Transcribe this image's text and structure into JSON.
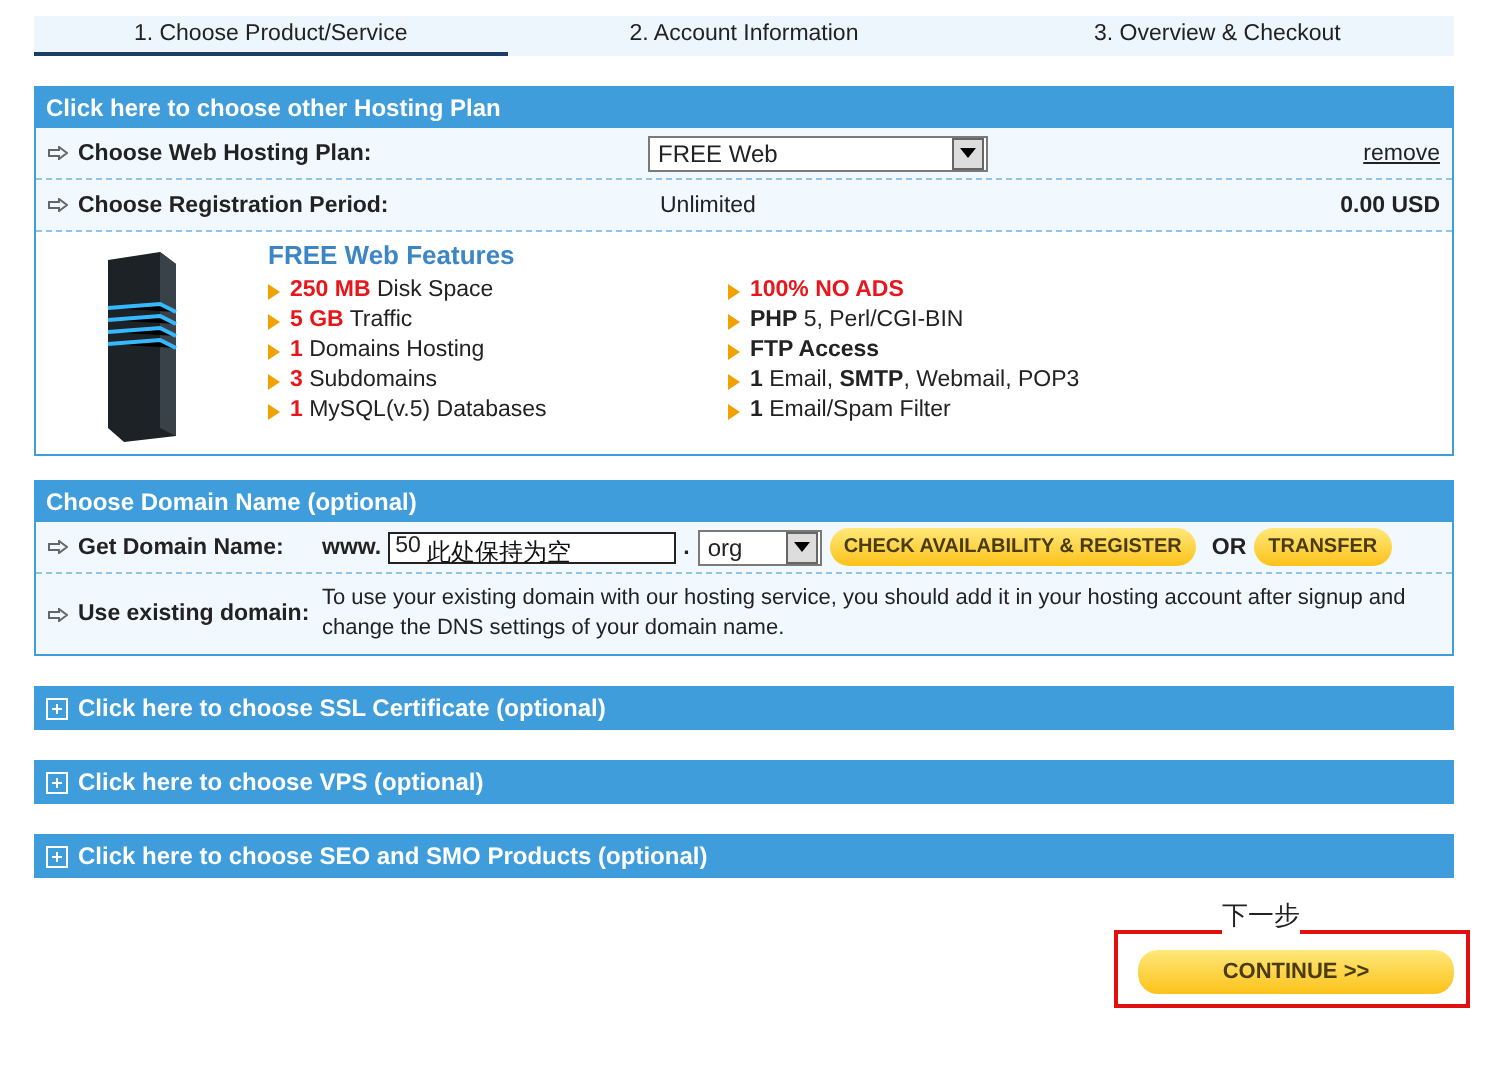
{
  "steps": [
    {
      "label": "1. Choose Product/Service",
      "selected": true
    },
    {
      "label": "2. Account Information",
      "selected": false
    },
    {
      "label": "3. Overview & Checkout",
      "selected": false
    }
  ],
  "hosting": {
    "header": "Click here to choose other Hosting Plan",
    "plan_label": "Choose Web Hosting Plan:",
    "plan_value": "FREE Web",
    "remove": "remove",
    "period_label": "Choose Registration Period:",
    "period_value": "Unlimited",
    "price": "0.00 USD",
    "features_title": "FREE Web Features",
    "features_left": [
      {
        "text": "**250 MB** Disk Space",
        "kind": "red"
      },
      {
        "text": "**5 GB** Traffic",
        "kind": "red"
      },
      {
        "text": "**1** Domains Hosting",
        "kind": "red"
      },
      {
        "text": "**3** Subdomains",
        "kind": "red"
      },
      {
        "text": "**1** MySQL(v.5) Databases",
        "kind": "red"
      }
    ],
    "features_right": [
      {
        "text": "100% NO ADS",
        "kind": "alert"
      },
      {
        "text": "**PHP** 5, Perl/CGI-BIN",
        "kind": "plain"
      },
      {
        "text": "FTP Access",
        "kind": "strong"
      },
      {
        "text": "**1** Email, **SMTP**, Webmail, POP3",
        "kind": "plain"
      },
      {
        "text": "**1** Email/Spam Filter",
        "kind": "plain"
      }
    ]
  },
  "domain": {
    "header": "Choose Domain Name (optional)",
    "get_label": "Get Domain Name:",
    "prefix": "www.",
    "value": "50",
    "note": "此处保持为空",
    "dot": ".",
    "tld": "org",
    "check_button": "CHECK AVAILABILITY & REGISTER",
    "or": "OR",
    "transfer_button": "TRANSFER",
    "existing_label": "Use existing domain:",
    "existing_text": "To use your existing domain with our hosting service, you should add it in your hosting account after signup and change the DNS settings of your domain name."
  },
  "sections": [
    {
      "label": "Click here to choose SSL Certificate (optional)",
      "expanded": false
    },
    {
      "label": "Click here to choose VPS (optional)",
      "expanded": false
    },
    {
      "label": "Click here to choose SEO and SMO Products (optional)",
      "expanded": false
    }
  ],
  "next_note": "下一步",
  "continue_button": "CONTINUE >>"
}
